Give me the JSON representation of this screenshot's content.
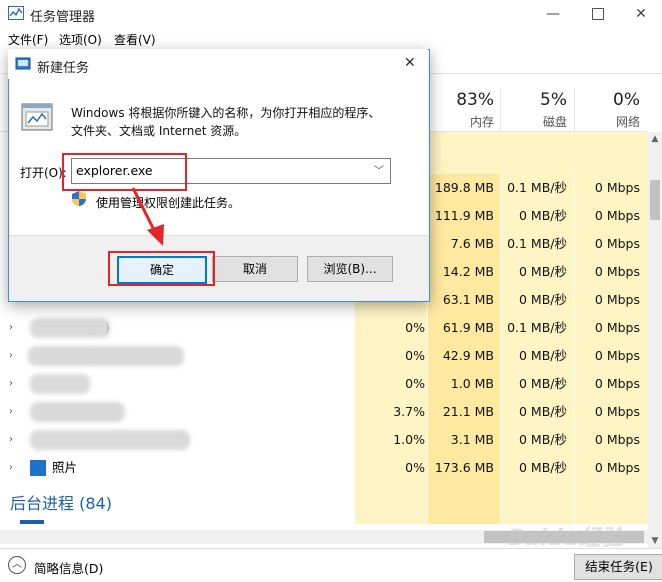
{
  "taskmgr": {
    "title": "任务管理器",
    "menu": [
      "文件(F)",
      "选项(O)",
      "查看(V)"
    ],
    "columns": [
      {
        "pct": "83%",
        "label": "内存"
      },
      {
        "pct": "5%",
        "label": "磁盘"
      },
      {
        "pct": "0%",
        "label": "网络"
      }
    ],
    "rows": [
      {
        "label": "",
        "cpu": "",
        "mem": "189.8 MB",
        "disk": "0.1 MB/秒",
        "net": "0 Mbps"
      },
      {
        "label": "",
        "cpu": "",
        "mem": "111.9 MB",
        "disk": "0 MB/秒",
        "net": "0 Mbps"
      },
      {
        "label": "",
        "cpu": "",
        "mem": "7.6 MB",
        "disk": "0.1 MB/秒",
        "net": "0 Mbps"
      },
      {
        "label": "",
        "cpu": "",
        "mem": "14.2 MB",
        "disk": "0 MB/秒",
        "net": "0 Mbps"
      },
      {
        "label": "",
        "cpu": "",
        "mem": "63.1 MB",
        "disk": "0 MB/秒",
        "net": "0 Mbps"
      },
      {
        "label": "(3)",
        "cpu": "0%",
        "mem": "61.9 MB",
        "disk": "0.1 MB/秒",
        "net": "0 Mbps"
      },
      {
        "label": ")",
        "cpu": "0%",
        "mem": "42.9 MB",
        "disk": "0 MB/秒",
        "net": "0 Mbps"
      },
      {
        "label": "",
        "cpu": "0%",
        "mem": "1.0 MB",
        "disk": "0 MB/秒",
        "net": "0 Mbps"
      },
      {
        "label": "",
        "cpu": "3.7%",
        "mem": "21.1 MB",
        "disk": "0 MB/秒",
        "net": "0 Mbps"
      },
      {
        "label": "",
        "cpu": "1.0%",
        "mem": "3.1 MB",
        "disk": "0 MB/秒",
        "net": "0 Mbps"
      },
      {
        "label": "照片",
        "cpu": "0%",
        "mem": "173.6 MB",
        "disk": "0 MB/秒",
        "net": "0 Mbps"
      }
    ],
    "section_background": "后台进程 (84)",
    "fewer_details": "简略信息(D)",
    "end_task": "结束任务(E)"
  },
  "dialog": {
    "title": "新建任务",
    "description_line1": "Windows 将根据你所键入的名称，为你打开相应的程序、",
    "description_line2": "文件夹、文档或 Internet 资源。",
    "open_label": "打开(O):",
    "input_value": "explorer.exe",
    "admin_checkbox_label": "使用管理权限创建此任务。",
    "ok_label": "确定",
    "cancel_label": "取消",
    "browse_label": "浏览(B)..."
  },
  "watermark": "Baidu经验",
  "colors": {
    "highlight_column": "#fff4c4",
    "highlight_column_strong": "#ffe8a0",
    "accent": "#0063b1",
    "annotation": "#e5242a"
  }
}
